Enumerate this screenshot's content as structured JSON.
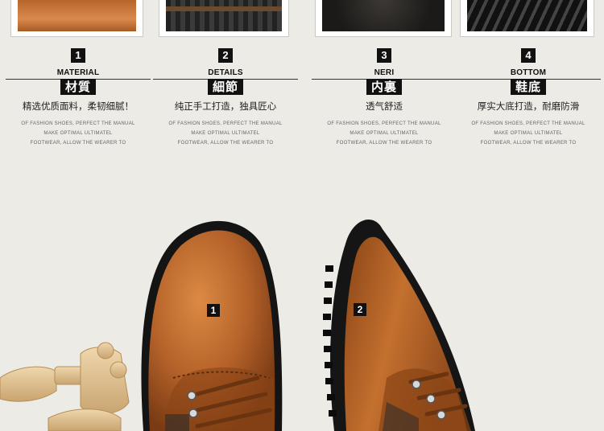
{
  "features": [
    {
      "num": "1",
      "en": "MATERIAL",
      "cn": "材質",
      "slogan": "精选优质面料，柔韧细腻！",
      "lines": [
        "OF FASHION SHOES, PERFECT THE MANUAL",
        "MAKE OPTIMAL ULTIMATEL",
        "FOOTWEAR, ALLOW THE WEARER TO"
      ]
    },
    {
      "num": "2",
      "en": "DETAILS",
      "cn": "細節",
      "slogan": "纯正手工打造，独具匠心",
      "lines": [
        "OF FASHION SHOES, PERFECT THE MANUAL",
        "MAKE OPTIMAL ULTIMATEL",
        "FOOTWEAR, ALLOW THE WEARER TO"
      ]
    },
    {
      "num": "3",
      "en": "NERI",
      "cn": "内裏",
      "slogan": "透气舒适",
      "lines": [
        "OF FASHION SHOES, PERFECT THE MANUAL",
        "MAKE OPTIMAL ULTIMATEL",
        "FOOTWEAR, ALLOW THE WEARER TO"
      ]
    },
    {
      "num": "4",
      "en": "BOTTOM",
      "cn": "鞋底",
      "slogan": "厚实大底打造，耐磨防滑",
      "lines": [
        "OF FASHION SHOES, PERFECT THE MANUAL",
        "MAKE OPTIMAL ULTIMATEL",
        "FOOTWEAR, ALLOW THE WEARER TO"
      ]
    }
  ],
  "markers": [
    "1",
    "2"
  ],
  "colors": {
    "background": "#ecebe6",
    "label": "#111111",
    "leather": "#b5622a"
  }
}
